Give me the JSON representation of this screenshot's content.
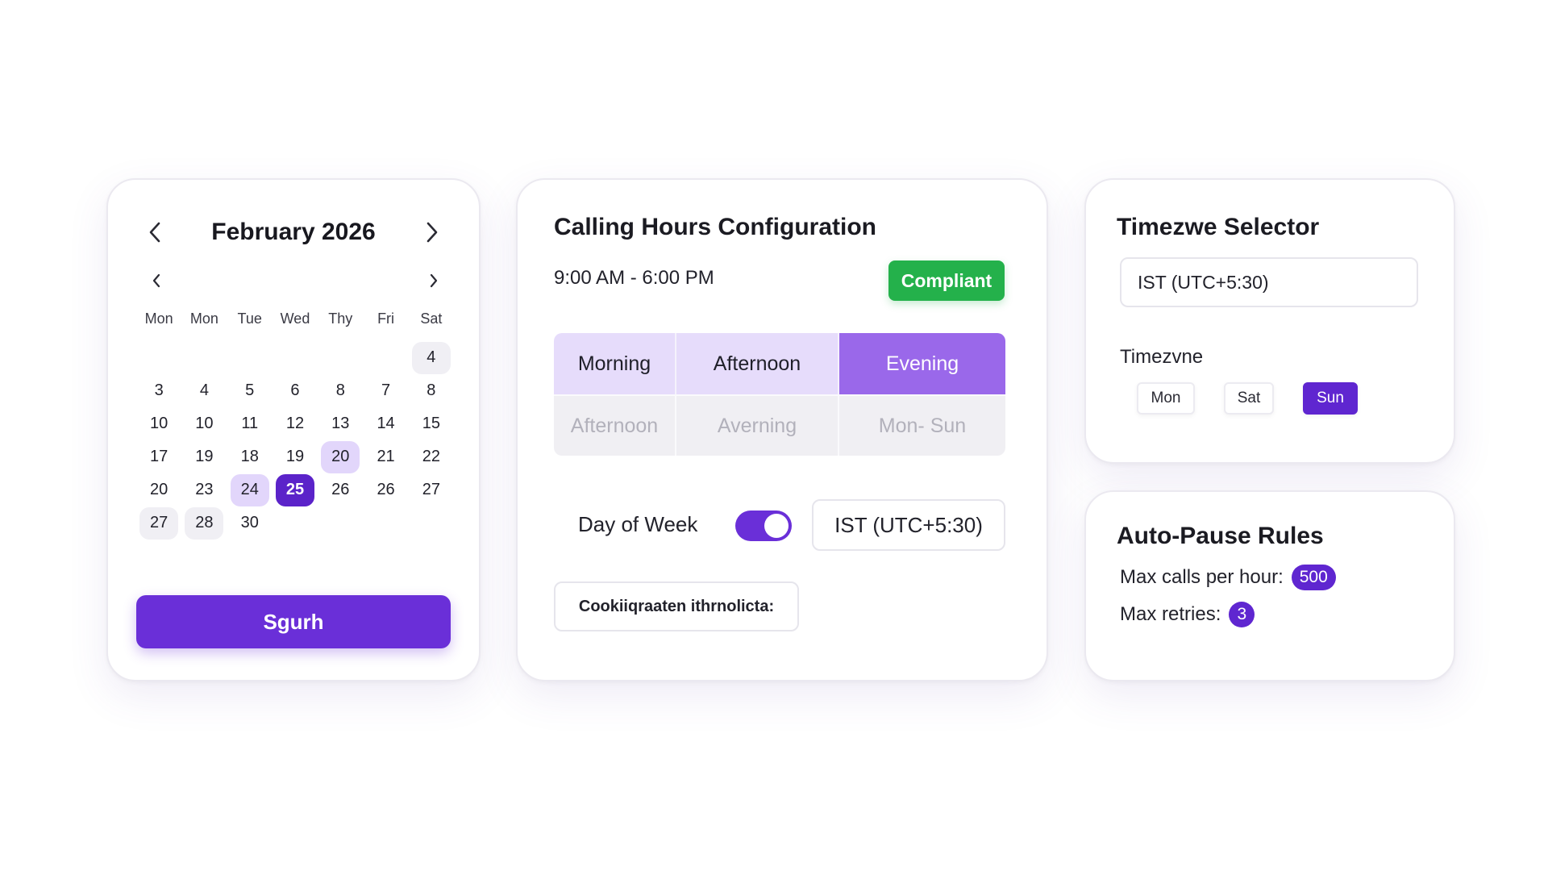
{
  "calendar": {
    "title": "February 2026",
    "weekdays": [
      "Mon",
      "Mon",
      "Tue",
      "Wed",
      "Thy",
      "Fri",
      "Sat"
    ],
    "days": [
      {
        "label": "",
        "state": "empty"
      },
      {
        "label": "",
        "state": "empty"
      },
      {
        "label": "",
        "state": "empty"
      },
      {
        "label": "",
        "state": "empty"
      },
      {
        "label": "",
        "state": "empty"
      },
      {
        "label": "",
        "state": "empty"
      },
      {
        "label": "4",
        "state": "muted"
      },
      {
        "label": "3",
        "state": "normal"
      },
      {
        "label": "4",
        "state": "normal"
      },
      {
        "label": "5",
        "state": "normal"
      },
      {
        "label": "6",
        "state": "normal"
      },
      {
        "label": "8",
        "state": "normal"
      },
      {
        "label": "7",
        "state": "normal"
      },
      {
        "label": "8",
        "state": "normal"
      },
      {
        "label": "10",
        "state": "normal"
      },
      {
        "label": "10",
        "state": "normal"
      },
      {
        "label": "11",
        "state": "normal"
      },
      {
        "label": "12",
        "state": "normal"
      },
      {
        "label": "13",
        "state": "normal"
      },
      {
        "label": "14",
        "state": "normal"
      },
      {
        "label": "15",
        "state": "normal"
      },
      {
        "label": "17",
        "state": "normal"
      },
      {
        "label": "19",
        "state": "normal"
      },
      {
        "label": "18",
        "state": "normal"
      },
      {
        "label": "19",
        "state": "normal"
      },
      {
        "label": "20",
        "state": "soft"
      },
      {
        "label": "21",
        "state": "normal"
      },
      {
        "label": "22",
        "state": "normal"
      },
      {
        "label": "20",
        "state": "normal"
      },
      {
        "label": "23",
        "state": "normal"
      },
      {
        "label": "24",
        "state": "soft"
      },
      {
        "label": "25",
        "state": "selected"
      },
      {
        "label": "26",
        "state": "normal"
      },
      {
        "label": "26",
        "state": "normal"
      },
      {
        "label": "27",
        "state": "normal"
      },
      {
        "label": "27",
        "state": "muted"
      },
      {
        "label": "28",
        "state": "muted"
      },
      {
        "label": "30",
        "state": "normal"
      }
    ],
    "button_label": "Sgurh"
  },
  "calling_hours": {
    "title": "Calling Hours Configuration",
    "hours": "9:00 AM - 6:00 PM",
    "status_badge": "Compliant",
    "segments": {
      "row1": [
        "Morning",
        "Afternoon",
        "Evening"
      ],
      "row2": [
        "Afternoon",
        "Averning",
        "Mon- Sun"
      ]
    },
    "day_of_week_label": "Day of Week",
    "day_of_week_enabled": true,
    "timezone_value": "IST (UTC+5:30)",
    "cookie_label": "Cookiiqraaten ithrnolicta:"
  },
  "timezone_selector": {
    "title": "Timezwe Selector",
    "input_value": "IST (UTC+5:30)",
    "sub_label": "Timezvne",
    "chips": [
      {
        "label": "Mon",
        "active": false
      },
      {
        "label": "Sat",
        "active": false
      },
      {
        "label": "Sun",
        "active": true
      }
    ]
  },
  "auto_pause": {
    "title": "Auto-Pause Rules",
    "max_calls_label": "Max calls per hour:",
    "max_calls_value": "500",
    "max_retries_label": "Max retries:",
    "max_retries_value": "3"
  },
  "colors": {
    "accent": "#6a2fd8",
    "accent_dark": "#5b23c9",
    "accent_soft": "#e6dcfb",
    "success": "#24b14b"
  }
}
